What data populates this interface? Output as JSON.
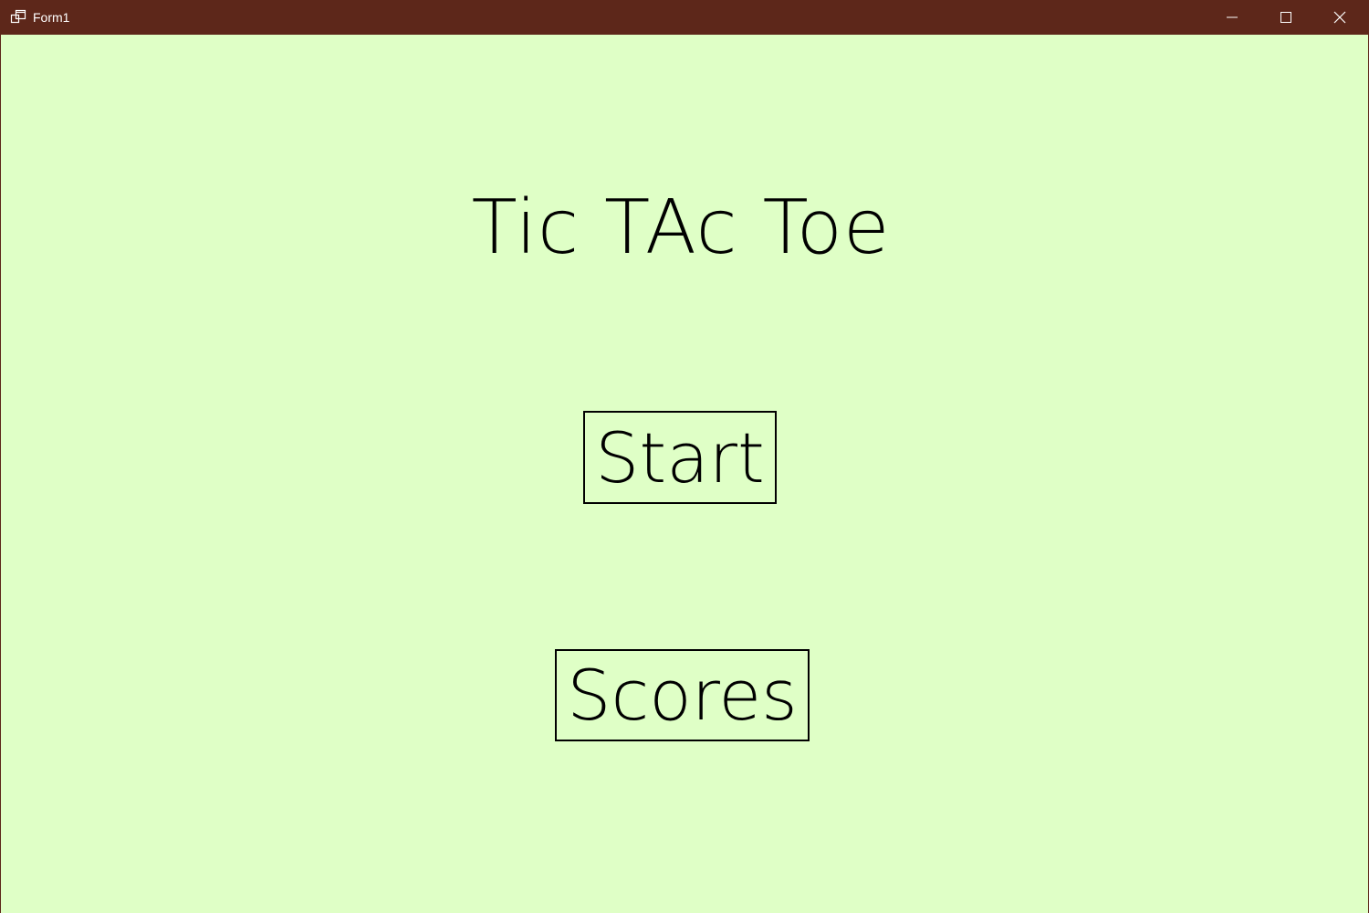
{
  "window": {
    "title": "Form1",
    "titlebar_color": "#5d271a",
    "background_color": "#dfffc6",
    "icons": {
      "app": "app-window-icon",
      "minimize": "minimize-icon",
      "maximize": "maximize-icon",
      "close": "close-icon"
    }
  },
  "main": {
    "heading": "Tic TAc Toe",
    "start_label": "Start",
    "scores_label": "Scores"
  }
}
